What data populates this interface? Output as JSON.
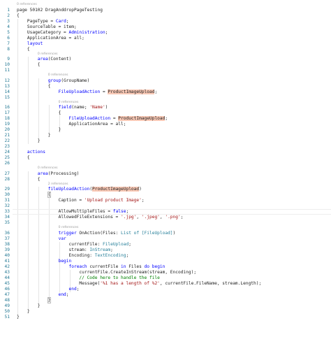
{
  "editor": {
    "code_lens_text": "0 references",
    "code_lens_text_alt": "2 references",
    "lines": [
      {
        "n": "1",
        "parts": [
          {
            "t": "page 50102 DragAnddropPageTesting"
          }
        ]
      },
      {
        "n": "2",
        "parts": [
          {
            "t": "{"
          }
        ]
      },
      {
        "n": "3",
        "parts": [
          {
            "t": "    PageType = "
          },
          {
            "t": "Card",
            "c": "tok-keyword"
          },
          {
            "t": ";"
          }
        ]
      },
      {
        "n": "4",
        "parts": [
          {
            "t": "    SourceTable = item;"
          }
        ]
      },
      {
        "n": "5",
        "parts": [
          {
            "t": "    UsageCategory = "
          },
          {
            "t": "Administration",
            "c": "tok-keyword"
          },
          {
            "t": ";"
          }
        ]
      },
      {
        "n": "6",
        "parts": [
          {
            "t": "    ApplicationArea = all;"
          }
        ]
      },
      {
        "n": "7",
        "parts": [
          {
            "t": "    layout",
            "c": "tok-keyword"
          }
        ]
      },
      {
        "n": "8",
        "parts": [
          {
            "t": "    {"
          }
        ]
      },
      {
        "n": "9",
        "parts": [
          {
            "t": "        area",
            "c": "tok-keyword"
          },
          {
            "t": "(Content)"
          }
        ]
      },
      {
        "n": "10",
        "parts": [
          {
            "t": "        {"
          }
        ]
      },
      {
        "n": "11",
        "parts": [
          {
            "t": ""
          }
        ]
      },
      {
        "n": "12",
        "parts": [
          {
            "t": "            group",
            "c": "tok-keyword"
          },
          {
            "t": "(GroupName)"
          }
        ]
      },
      {
        "n": "13",
        "parts": [
          {
            "t": "            {"
          }
        ]
      },
      {
        "n": "14",
        "parts": [
          {
            "t": "                FileUploadAction",
            "c": "tok-keyword"
          },
          {
            "t": " = "
          },
          {
            "t": "ProductImageUpload",
            "c": "hl"
          },
          {
            "t": ";"
          }
        ]
      },
      {
        "n": "15",
        "parts": [
          {
            "t": ""
          }
        ]
      },
      {
        "n": "16",
        "parts": [
          {
            "t": "                field",
            "c": "tok-keyword"
          },
          {
            "t": "(name; "
          },
          {
            "t": "'Name'",
            "c": "tok-string"
          },
          {
            "t": ")"
          }
        ]
      },
      {
        "n": "17",
        "parts": [
          {
            "t": "                {"
          }
        ]
      },
      {
        "n": "18",
        "parts": [
          {
            "t": "                    FileUploadAction",
            "c": "tok-keyword"
          },
          {
            "t": " = "
          },
          {
            "t": "ProductImageUpload",
            "c": "hl"
          },
          {
            "t": ";"
          }
        ]
      },
      {
        "n": "19",
        "parts": [
          {
            "t": "                    ApplicationArea = all;"
          }
        ]
      },
      {
        "n": "20",
        "parts": [
          {
            "t": "                }"
          }
        ]
      },
      {
        "n": "21",
        "parts": [
          {
            "t": "            }"
          }
        ]
      },
      {
        "n": "22",
        "parts": [
          {
            "t": "        }"
          }
        ]
      },
      {
        "n": "23",
        "parts": [
          {
            "t": ""
          }
        ]
      },
      {
        "n": "24",
        "parts": [
          {
            "t": "    actions",
            "c": "tok-keyword"
          }
        ]
      },
      {
        "n": "25",
        "parts": [
          {
            "t": "    {"
          }
        ]
      },
      {
        "n": "26",
        "parts": [
          {
            "t": ""
          }
        ]
      },
      {
        "n": "27",
        "parts": [
          {
            "t": "        area",
            "c": "tok-keyword"
          },
          {
            "t": "(Processing)"
          }
        ]
      },
      {
        "n": "28",
        "parts": [
          {
            "t": "        {"
          }
        ]
      },
      {
        "n": "29",
        "parts": [
          {
            "t": "            fileUploadAction",
            "c": "tok-keyword"
          },
          {
            "t": "("
          },
          {
            "t": "ProductImageUpload",
            "c": "hl"
          },
          {
            "t": ")"
          }
        ]
      },
      {
        "n": "30",
        "parts": [
          {
            "t": "            "
          },
          {
            "t": "{",
            "c": "bm"
          }
        ]
      },
      {
        "n": "31",
        "parts": [
          {
            "t": "                Caption = "
          },
          {
            "t": "'Upload product Image'",
            "c": "tok-string"
          },
          {
            "t": ";"
          }
        ]
      },
      {
        "n": "32",
        "parts": [
          {
            "t": ""
          }
        ]
      },
      {
        "n": "33",
        "parts": [
          {
            "t": "                AllowMultipleFiles = "
          },
          {
            "t": "false",
            "c": "tok-keyword"
          },
          {
            "t": ";"
          }
        ]
      },
      {
        "n": "34",
        "parts": [
          {
            "t": "                AllowedFileExtensions = "
          },
          {
            "t": "'.jpg'",
            "c": "tok-string"
          },
          {
            "t": ", "
          },
          {
            "t": "'.jpeg'",
            "c": "tok-string"
          },
          {
            "t": ", "
          },
          {
            "t": "'.png'",
            "c": "tok-string"
          },
          {
            "t": ";"
          }
        ]
      },
      {
        "n": "35",
        "parts": [
          {
            "t": ""
          }
        ]
      },
      {
        "n": "36",
        "parts": [
          {
            "t": "                trigger",
            "c": "tok-keyword"
          },
          {
            "t": " OnAction(Files: "
          },
          {
            "t": "List of [FileUpload]",
            "c": "tok-type"
          },
          {
            "t": ")"
          }
        ]
      },
      {
        "n": "37",
        "parts": [
          {
            "t": "                var",
            "c": "tok-keyword"
          }
        ]
      },
      {
        "n": "38",
        "parts": [
          {
            "t": "                    currentFile: "
          },
          {
            "t": "FileUpload",
            "c": "tok-type"
          },
          {
            "t": ";"
          }
        ]
      },
      {
        "n": "39",
        "parts": [
          {
            "t": "                    stream: "
          },
          {
            "t": "InStream",
            "c": "tok-type"
          },
          {
            "t": ";"
          }
        ]
      },
      {
        "n": "40",
        "parts": [
          {
            "t": "                    Encoding: "
          },
          {
            "t": "TextEncoding",
            "c": "tok-type"
          },
          {
            "t": ";"
          }
        ]
      },
      {
        "n": "41",
        "parts": [
          {
            "t": "                begin",
            "c": "tok-keyword"
          }
        ]
      },
      {
        "n": "42",
        "parts": [
          {
            "t": "                    "
          },
          {
            "t": "foreach",
            "c": "tok-keyword"
          },
          {
            "t": " currentFile "
          },
          {
            "t": "in",
            "c": "tok-keyword"
          },
          {
            "t": " Files "
          },
          {
            "t": "do begin",
            "c": "tok-keyword"
          }
        ]
      },
      {
        "n": "43",
        "parts": [
          {
            "t": "                        currentFile.CreateInStream(stream, Encoding);"
          }
        ]
      },
      {
        "n": "44",
        "parts": [
          {
            "t": "                        "
          },
          {
            "t": "// Code here to handle the file",
            "c": "tok-comment"
          }
        ]
      },
      {
        "n": "45",
        "parts": [
          {
            "t": "                        Message("
          },
          {
            "t": "'%1 has a length of %2'",
            "c": "tok-string"
          },
          {
            "t": ", currentFile.FileName, stream.Length);"
          }
        ]
      },
      {
        "n": "46",
        "parts": [
          {
            "t": "                    "
          },
          {
            "t": "end",
            "c": "tok-keyword"
          },
          {
            "t": ";"
          }
        ]
      },
      {
        "n": "47",
        "parts": [
          {
            "t": "                "
          },
          {
            "t": "end",
            "c": "tok-keyword"
          },
          {
            "t": ";"
          }
        ]
      },
      {
        "n": "48",
        "parts": [
          {
            "t": "            "
          },
          {
            "t": "}",
            "c": "bm"
          }
        ]
      },
      {
        "n": "49",
        "parts": [
          {
            "t": "        }"
          }
        ]
      },
      {
        "n": "50",
        "parts": [
          {
            "t": "    }"
          }
        ]
      },
      {
        "n": "51",
        "parts": [
          {
            "t": "}"
          }
        ]
      }
    ]
  }
}
